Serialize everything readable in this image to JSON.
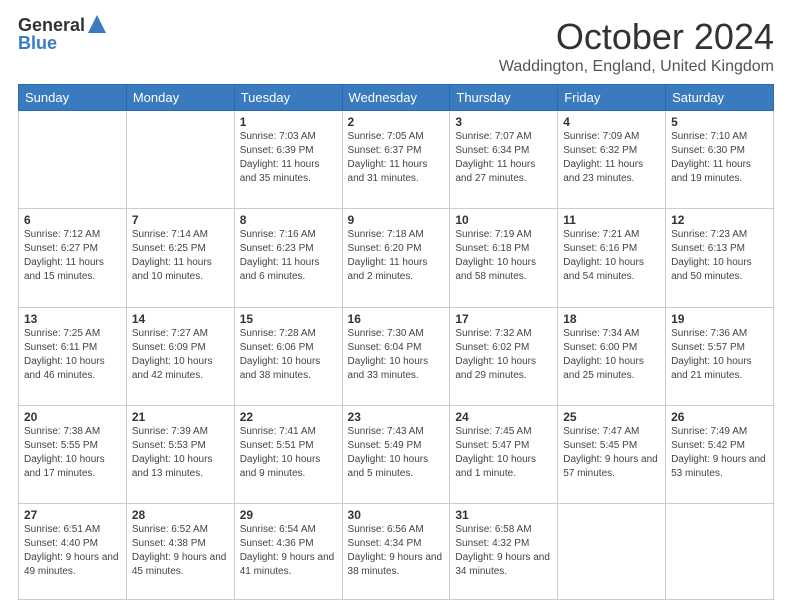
{
  "logo": {
    "line1": "General",
    "line2": "Blue"
  },
  "title": "October 2024",
  "subtitle": "Waddington, England, United Kingdom",
  "days_header": [
    "Sunday",
    "Monday",
    "Tuesday",
    "Wednesday",
    "Thursday",
    "Friday",
    "Saturday"
  ],
  "weeks": [
    [
      {
        "num": "",
        "sunrise": "",
        "sunset": "",
        "daylight": ""
      },
      {
        "num": "",
        "sunrise": "",
        "sunset": "",
        "daylight": ""
      },
      {
        "num": "1",
        "sunrise": "Sunrise: 7:03 AM",
        "sunset": "Sunset: 6:39 PM",
        "daylight": "Daylight: 11 hours and 35 minutes."
      },
      {
        "num": "2",
        "sunrise": "Sunrise: 7:05 AM",
        "sunset": "Sunset: 6:37 PM",
        "daylight": "Daylight: 11 hours and 31 minutes."
      },
      {
        "num": "3",
        "sunrise": "Sunrise: 7:07 AM",
        "sunset": "Sunset: 6:34 PM",
        "daylight": "Daylight: 11 hours and 27 minutes."
      },
      {
        "num": "4",
        "sunrise": "Sunrise: 7:09 AM",
        "sunset": "Sunset: 6:32 PM",
        "daylight": "Daylight: 11 hours and 23 minutes."
      },
      {
        "num": "5",
        "sunrise": "Sunrise: 7:10 AM",
        "sunset": "Sunset: 6:30 PM",
        "daylight": "Daylight: 11 hours and 19 minutes."
      }
    ],
    [
      {
        "num": "6",
        "sunrise": "Sunrise: 7:12 AM",
        "sunset": "Sunset: 6:27 PM",
        "daylight": "Daylight: 11 hours and 15 minutes."
      },
      {
        "num": "7",
        "sunrise": "Sunrise: 7:14 AM",
        "sunset": "Sunset: 6:25 PM",
        "daylight": "Daylight: 11 hours and 10 minutes."
      },
      {
        "num": "8",
        "sunrise": "Sunrise: 7:16 AM",
        "sunset": "Sunset: 6:23 PM",
        "daylight": "Daylight: 11 hours and 6 minutes."
      },
      {
        "num": "9",
        "sunrise": "Sunrise: 7:18 AM",
        "sunset": "Sunset: 6:20 PM",
        "daylight": "Daylight: 11 hours and 2 minutes."
      },
      {
        "num": "10",
        "sunrise": "Sunrise: 7:19 AM",
        "sunset": "Sunset: 6:18 PM",
        "daylight": "Daylight: 10 hours and 58 minutes."
      },
      {
        "num": "11",
        "sunrise": "Sunrise: 7:21 AM",
        "sunset": "Sunset: 6:16 PM",
        "daylight": "Daylight: 10 hours and 54 minutes."
      },
      {
        "num": "12",
        "sunrise": "Sunrise: 7:23 AM",
        "sunset": "Sunset: 6:13 PM",
        "daylight": "Daylight: 10 hours and 50 minutes."
      }
    ],
    [
      {
        "num": "13",
        "sunrise": "Sunrise: 7:25 AM",
        "sunset": "Sunset: 6:11 PM",
        "daylight": "Daylight: 10 hours and 46 minutes."
      },
      {
        "num": "14",
        "sunrise": "Sunrise: 7:27 AM",
        "sunset": "Sunset: 6:09 PM",
        "daylight": "Daylight: 10 hours and 42 minutes."
      },
      {
        "num": "15",
        "sunrise": "Sunrise: 7:28 AM",
        "sunset": "Sunset: 6:06 PM",
        "daylight": "Daylight: 10 hours and 38 minutes."
      },
      {
        "num": "16",
        "sunrise": "Sunrise: 7:30 AM",
        "sunset": "Sunset: 6:04 PM",
        "daylight": "Daylight: 10 hours and 33 minutes."
      },
      {
        "num": "17",
        "sunrise": "Sunrise: 7:32 AM",
        "sunset": "Sunset: 6:02 PM",
        "daylight": "Daylight: 10 hours and 29 minutes."
      },
      {
        "num": "18",
        "sunrise": "Sunrise: 7:34 AM",
        "sunset": "Sunset: 6:00 PM",
        "daylight": "Daylight: 10 hours and 25 minutes."
      },
      {
        "num": "19",
        "sunrise": "Sunrise: 7:36 AM",
        "sunset": "Sunset: 5:57 PM",
        "daylight": "Daylight: 10 hours and 21 minutes."
      }
    ],
    [
      {
        "num": "20",
        "sunrise": "Sunrise: 7:38 AM",
        "sunset": "Sunset: 5:55 PM",
        "daylight": "Daylight: 10 hours and 17 minutes."
      },
      {
        "num": "21",
        "sunrise": "Sunrise: 7:39 AM",
        "sunset": "Sunset: 5:53 PM",
        "daylight": "Daylight: 10 hours and 13 minutes."
      },
      {
        "num": "22",
        "sunrise": "Sunrise: 7:41 AM",
        "sunset": "Sunset: 5:51 PM",
        "daylight": "Daylight: 10 hours and 9 minutes."
      },
      {
        "num": "23",
        "sunrise": "Sunrise: 7:43 AM",
        "sunset": "Sunset: 5:49 PM",
        "daylight": "Daylight: 10 hours and 5 minutes."
      },
      {
        "num": "24",
        "sunrise": "Sunrise: 7:45 AM",
        "sunset": "Sunset: 5:47 PM",
        "daylight": "Daylight: 10 hours and 1 minute."
      },
      {
        "num": "25",
        "sunrise": "Sunrise: 7:47 AM",
        "sunset": "Sunset: 5:45 PM",
        "daylight": "Daylight: 9 hours and 57 minutes."
      },
      {
        "num": "26",
        "sunrise": "Sunrise: 7:49 AM",
        "sunset": "Sunset: 5:42 PM",
        "daylight": "Daylight: 9 hours and 53 minutes."
      }
    ],
    [
      {
        "num": "27",
        "sunrise": "Sunrise: 6:51 AM",
        "sunset": "Sunset: 4:40 PM",
        "daylight": "Daylight: 9 hours and 49 minutes."
      },
      {
        "num": "28",
        "sunrise": "Sunrise: 6:52 AM",
        "sunset": "Sunset: 4:38 PM",
        "daylight": "Daylight: 9 hours and 45 minutes."
      },
      {
        "num": "29",
        "sunrise": "Sunrise: 6:54 AM",
        "sunset": "Sunset: 4:36 PM",
        "daylight": "Daylight: 9 hours and 41 minutes."
      },
      {
        "num": "30",
        "sunrise": "Sunrise: 6:56 AM",
        "sunset": "Sunset: 4:34 PM",
        "daylight": "Daylight: 9 hours and 38 minutes."
      },
      {
        "num": "31",
        "sunrise": "Sunrise: 6:58 AM",
        "sunset": "Sunset: 4:32 PM",
        "daylight": "Daylight: 9 hours and 34 minutes."
      },
      {
        "num": "",
        "sunrise": "",
        "sunset": "",
        "daylight": ""
      },
      {
        "num": "",
        "sunrise": "",
        "sunset": "",
        "daylight": ""
      }
    ]
  ]
}
